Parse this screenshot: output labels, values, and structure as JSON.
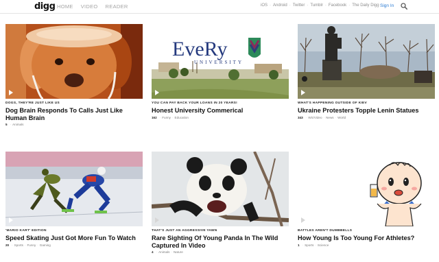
{
  "header": {
    "logo": "digg",
    "nav": [
      "HOME",
      "VIDEO",
      "READER"
    ],
    "sub_links": [
      "iOS",
      "Android",
      "Twitter",
      "Tumblr",
      "Facebook",
      "The Daily Digg"
    ],
    "separator": "·",
    "sign_in": "Sign In",
    "search_icon": "magnifier-icon"
  },
  "stories": [
    {
      "kicker": "DOGS, THEY'RE JUST LIKE US",
      "headline": "Dog Brain Responds To Calls Just Like Human Brain",
      "count": "5",
      "tags": [
        "Animals"
      ],
      "media_icon": "play-icon"
    },
    {
      "kicker": "YOU CAN PAY BACK YOUR LOANS IN 20 YEARS!",
      "headline": "Honest University Commerical",
      "count": "162",
      "tags": [
        "Funny",
        "Education"
      ],
      "media_icon": "play-icon",
      "image_text": {
        "brand": "EveRy",
        "sub": "UNIVERSITY"
      }
    },
    {
      "kicker": "WHAT'S HAPPENING OUTSIDE OF KIEV",
      "headline": "Ukraine Protesters Topple Lenin Statues",
      "count": "343",
      "tags": [
        "WS/Video",
        "News",
        "World"
      ],
      "media_icon": "play-icon"
    },
    {
      "kicker": "'MARIO KART' EDITION",
      "headline": "Speed Skating Just Got More Fun To Watch",
      "count": "20",
      "tags": [
        "Sports",
        "Funny",
        "Gaming"
      ],
      "media_icon": "play-icon"
    },
    {
      "kicker": "THAT'S JUST AN AGGRESSIVE YAWN",
      "headline": "Rare Sighting Of Young Panda In The Wild Captured In Video",
      "count": "4",
      "tags": [
        "Animals",
        "Nature"
      ],
      "media_icon": "play-icon"
    },
    {
      "kicker": "BATTLES AREN'T DUMBBELLS",
      "headline": "How Young Is Too Young For Athletes?",
      "count": "1",
      "tags": [
        "Sports",
        "Science"
      ],
      "media_icon": "play-icon"
    }
  ],
  "colors": {
    "accent": "#2b7bd3",
    "nav_gray": "#a4a4a4",
    "rule": "#e4e4e4"
  }
}
